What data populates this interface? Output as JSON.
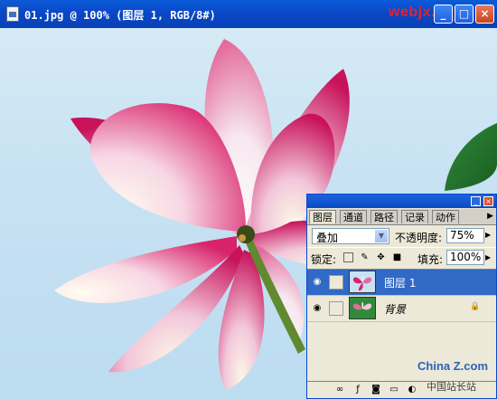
{
  "document": {
    "title": "01.jpg @ 100% (图层 1, RGB/8#)",
    "watermark": "webjx.com"
  },
  "layers_panel": {
    "tabs": [
      "图层",
      "通道",
      "路径",
      "记录",
      "动作"
    ],
    "active_tab": "图层",
    "blend_mode": "叠加",
    "opacity_label": "不透明度:",
    "opacity_value": "75%",
    "lock_label": "锁定:",
    "fill_label": "填充:",
    "fill_value": "100%",
    "layers": [
      {
        "name": "图层 1",
        "selected": true,
        "visible": true
      },
      {
        "name": "背景",
        "selected": false,
        "visible": true,
        "locked": true
      }
    ]
  },
  "bottom_watermark": {
    "main": "China Z.com",
    "sub": "中国站长站"
  },
  "colors": {
    "titlebar": "#0a48c8",
    "selected_layer": "#3169c6",
    "sky": "#bcdcf0",
    "petal_pink": "#d81b63"
  }
}
